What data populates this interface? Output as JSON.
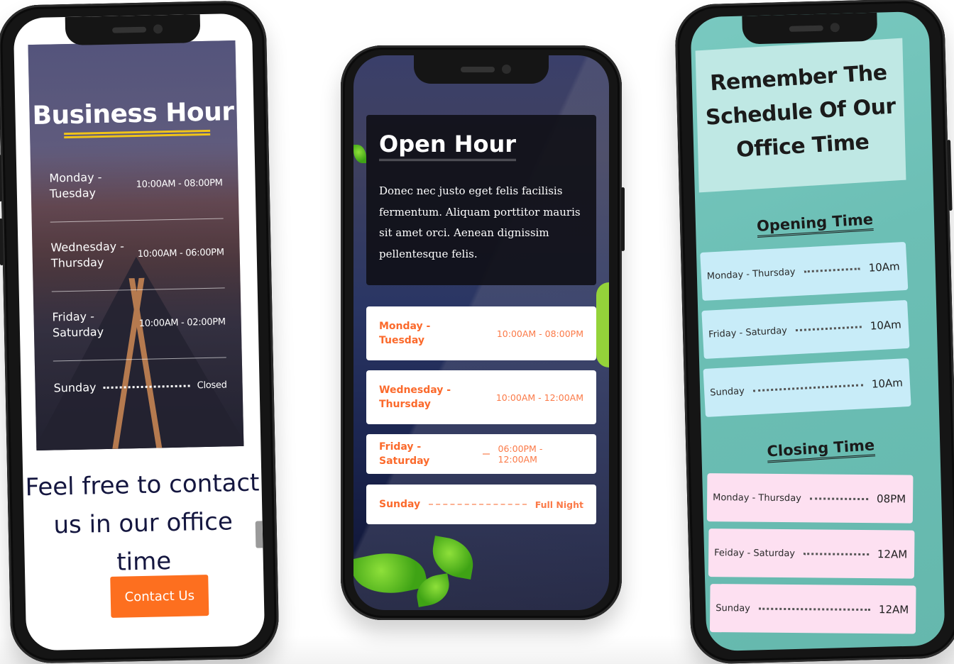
{
  "phone1": {
    "title": "Business Hour",
    "rows": [
      {
        "day": "Monday - Tuesday",
        "time": "10:00AM - 08:00PM"
      },
      {
        "day": "Wednesday - Thursday",
        "time": "10:00AM - 06:00PM"
      },
      {
        "day": "Friday - Saturday",
        "time": "10:00AM - 02:00PM"
      },
      {
        "day": "Sunday",
        "time": "Closed"
      }
    ],
    "contact_heading": "Feel free to contact us in our office time",
    "contact_button": "Contact Us",
    "colors": {
      "accent": "#fd6f1f",
      "underline": "#f0c419",
      "heading": "#14163f"
    }
  },
  "phone2": {
    "title": "Open Hour",
    "description": "Donec nec justo eget felis facilisis fermentum. Aliquam porttitor mauris sit amet orci. Aenean dignissim pellentesque felis.",
    "rows": [
      {
        "day": "Monday - Tuesday",
        "time": "10:00AM - 08:00PM"
      },
      {
        "day": "Wednesday - Thursday",
        "time": "10:00AM - 12:00AM"
      },
      {
        "day": "Friday - Saturday",
        "time": "06:00PM - 12:00AM"
      },
      {
        "day": "Sunday",
        "time": "Full Night"
      }
    ],
    "colors": {
      "accent": "#fb6a2c"
    }
  },
  "phone3": {
    "title": "Remember The Schedule Of Our Office Time",
    "opening": {
      "heading": "Opening Time",
      "rows": [
        {
          "day": "Monday - Thursday",
          "time": "10Am"
        },
        {
          "day": "Friday - Saturday",
          "time": "10Am"
        },
        {
          "day": "Sunday",
          "time": "10Am"
        }
      ]
    },
    "closing": {
      "heading": "Closing Time",
      "rows": [
        {
          "day": "Monday - Thursday",
          "time": "08PM"
        },
        {
          "day": "Feiday - Saturday",
          "time": "12AM"
        },
        {
          "day": "Sunday",
          "time": "12AM"
        }
      ]
    },
    "colors": {
      "background": "#6cbfb5",
      "open_row": "#c8ecf8",
      "close_row": "#fde0f1"
    }
  }
}
